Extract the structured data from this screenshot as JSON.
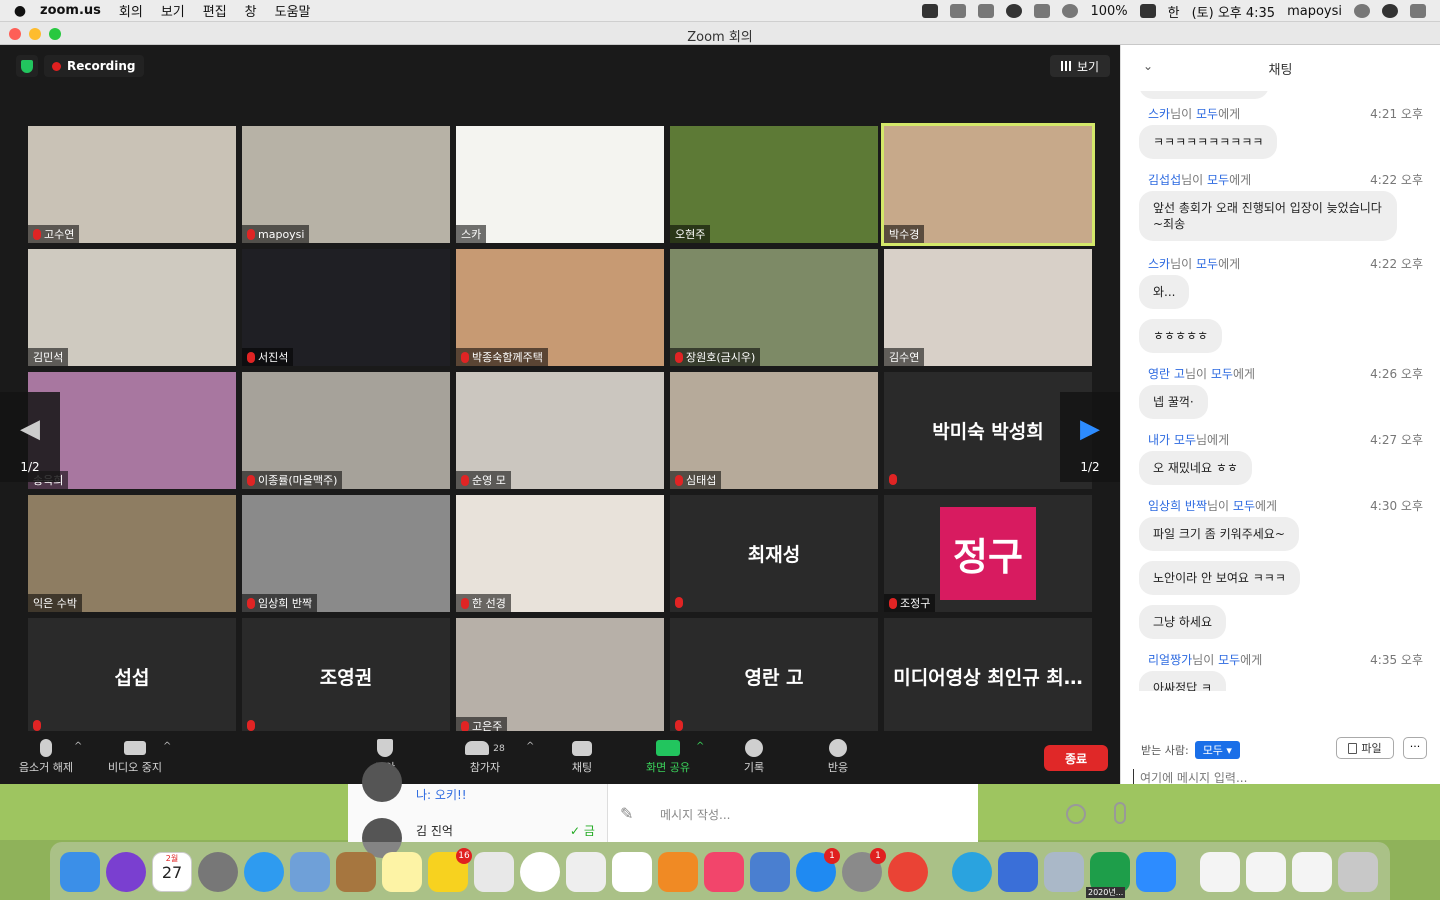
{
  "menubar": {
    "app": "zoom.us",
    "menus": [
      "회의",
      "보기",
      "편집",
      "창",
      "도움말"
    ],
    "battery": "100%",
    "input_lang": "한",
    "clock": "(토) 오후 4:35",
    "user": "mapoysi"
  },
  "window": {
    "title": "Zoom 회의"
  },
  "meeting": {
    "recording_label": "Recording",
    "view_label": "보기",
    "page_indicator_left": "1/2",
    "page_indicator_right": "1/2",
    "tiles": [
      {
        "name": "고수연",
        "muted": true,
        "video": true,
        "color": "#c9c2b6",
        "active": false
      },
      {
        "name": "mapoysi",
        "muted": true,
        "video": true,
        "color": "#b7b2a6",
        "active": false
      },
      {
        "name": "스카",
        "muted": false,
        "video": true,
        "color": "#f4f4f0",
        "active": false
      },
      {
        "name": "오현주",
        "muted": false,
        "video": true,
        "color": "#5d7a36",
        "active": false
      },
      {
        "name": "박수경",
        "muted": false,
        "video": true,
        "color": "#c7a98a",
        "active": true
      },
      {
        "name": "김민석",
        "muted": false,
        "video": true,
        "color": "#cfcac0",
        "active": false
      },
      {
        "name": "서진석",
        "muted": true,
        "video": true,
        "color": "#1f1f24",
        "active": false
      },
      {
        "name": "박종숙함께주택",
        "muted": true,
        "video": true,
        "color": "#c79a73",
        "active": false
      },
      {
        "name": "장원호(금시우)",
        "muted": true,
        "video": true,
        "color": "#7d8a66",
        "active": false
      },
      {
        "name": "김수연",
        "muted": false,
        "video": true,
        "color": "#d8d0c8",
        "active": false
      },
      {
        "name": "송욱희",
        "muted": false,
        "video": true,
        "color": "#a877a0",
        "active": false
      },
      {
        "name": "이종률(마을맥주)",
        "muted": true,
        "video": true,
        "color": "#a6a29a",
        "active": false
      },
      {
        "name": "순영 모",
        "muted": true,
        "video": true,
        "color": "#cbc6bf",
        "active": false
      },
      {
        "name": "심태섭",
        "muted": true,
        "video": true,
        "color": "#b6aa9a",
        "active": false
      },
      {
        "name": "박미숙 박성희",
        "muted": true,
        "video": false,
        "color": "#2a2a2a",
        "active": false
      },
      {
        "name": "익은 수박",
        "muted": false,
        "video": true,
        "color": "#8e7d62",
        "active": false
      },
      {
        "name": "임상희 반짝",
        "muted": true,
        "video": true,
        "color": "#8a8a8a",
        "active": false
      },
      {
        "name": "한 선경",
        "muted": true,
        "video": true,
        "color": "#e8e2da",
        "active": false
      },
      {
        "name": "최재성",
        "muted": true,
        "video": false,
        "color": "#2a2a2a",
        "active": false
      },
      {
        "name": "조정구",
        "muted": true,
        "video": true,
        "color": "#d81b60",
        "active": false,
        "logo": "정구"
      },
      {
        "name": "섭섭",
        "muted": true,
        "video": false,
        "color": "#2a2a2a",
        "active": false
      },
      {
        "name": "조영권",
        "muted": true,
        "video": false,
        "color": "#2a2a2a",
        "active": false
      },
      {
        "name": "고은주",
        "muted": true,
        "video": true,
        "color": "#b7b0a8",
        "active": false
      },
      {
        "name": "영란 고",
        "muted": true,
        "video": false,
        "color": "#2a2a2a",
        "active": false
      },
      {
        "name": "미디어영상 최인규 최…",
        "muted": false,
        "video": false,
        "color": "#2a2a2a",
        "active": false
      }
    ]
  },
  "toolbar": {
    "unmute": "음소거 해제",
    "stop_video": "비디오 중지",
    "security": "보안",
    "participants": "참가자",
    "participants_count": "28",
    "chat": "채팅",
    "share": "화면 공유",
    "record": "기록",
    "reactions": "반응",
    "end": "종료"
  },
  "chat": {
    "title": "채팅",
    "messages": [
      {
        "from": "스카",
        "suffix": "님이 ",
        "to": "모두",
        "to_suffix": "에게",
        "time": "4:21 오후",
        "texts": [
          "ㅋㅋㅋㅋㅋㅋㅋㅋㅋㅋ"
        ]
      },
      {
        "from": "김섭섭",
        "suffix": "님이 ",
        "to": "모두",
        "to_suffix": "에게",
        "time": "4:22 오후",
        "texts": [
          "앞선 총회가 오래 진행되어 입장이 늦었습니다~죄송"
        ]
      },
      {
        "from": "스카",
        "suffix": "님이 ",
        "to": "모두",
        "to_suffix": "에게",
        "time": "4:22 오후",
        "texts": [
          "와...",
          "ㅎㅎㅎㅎㅎ"
        ]
      },
      {
        "from": "영란 고",
        "suffix": "님이 ",
        "to": "모두",
        "to_suffix": "에게",
        "time": "4:26 오후",
        "texts": [
          "넵 꿀꺽·"
        ]
      },
      {
        "from": "내가",
        "suffix": " ",
        "to": "모두",
        "to_suffix": "님에게",
        "time": "4:27 오후",
        "texts": [
          "오 재밌네요 ㅎㅎ"
        ]
      },
      {
        "from": "임상희 반짝",
        "suffix": "님이 ",
        "to": "모두",
        "to_suffix": "에게",
        "time": "4:30 오후",
        "texts": [
          "파일 크기 좀 키워주세요~",
          "노안이라 안 보여요 ㅋㅋㅋ",
          "그냥 하세요"
        ]
      },
      {
        "from": "리얼짱가",
        "suffix": "님이 ",
        "to": "모두",
        "to_suffix": "에게",
        "time": "4:35 오후",
        "texts": [
          "아싸정답 ㅋ"
        ]
      }
    ],
    "recipient_label": "받는 사람:",
    "recipient_value": "모두",
    "file_label": "파일",
    "more_label": "···",
    "input_placeholder": "여기에 메시지 입력..."
  },
  "kakao": {
    "preview_1": "나: 오키!!",
    "preview_2_name": "김 진억",
    "preview_2_time": "금",
    "compose_placeholder": "메시지 작성..."
  },
  "dock": {
    "calendar_month": "2월",
    "calendar_day": "27",
    "talk_badge": "16",
    "appstore_badge": "1",
    "prefs_badge": "1",
    "numbers_label": "2020년..."
  }
}
